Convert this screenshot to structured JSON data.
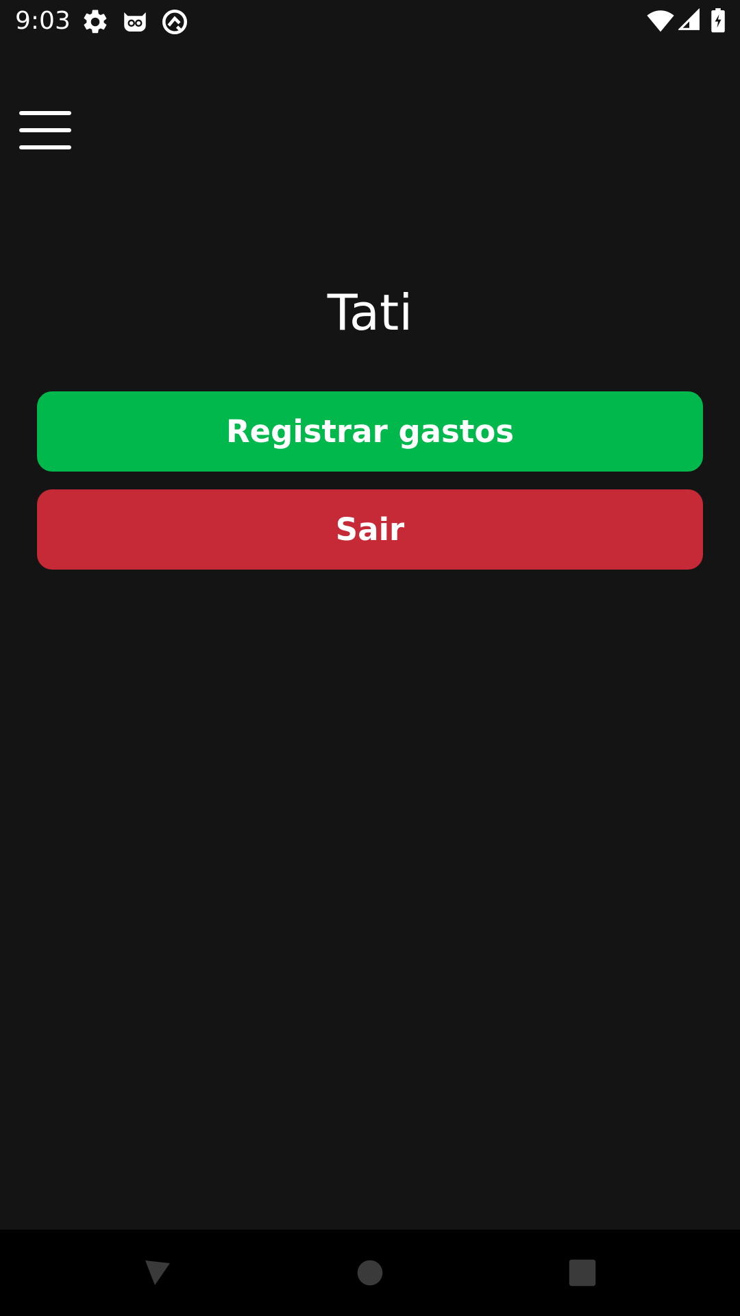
{
  "status_bar": {
    "time": "9:03",
    "icons": [
      "gear-icon",
      "cat-mask-icon",
      "circle-logo-icon"
    ],
    "right_icons": [
      "wifi-icon",
      "cell-signal-icon",
      "battery-charging-icon"
    ]
  },
  "header": {
    "menu_icon": "hamburger-menu-icon"
  },
  "main": {
    "user_name": "Tati",
    "register_label": "Registrar gastos",
    "logout_label": "Sair"
  },
  "colors": {
    "background": "#141414",
    "register_button": "#00b84c",
    "logout_button": "#c62a37",
    "nav_bar": "#000000",
    "nav_icons": "#3a3a3a"
  },
  "nav_bar": {
    "icons": [
      "back-icon",
      "home-icon",
      "recents-icon"
    ]
  }
}
